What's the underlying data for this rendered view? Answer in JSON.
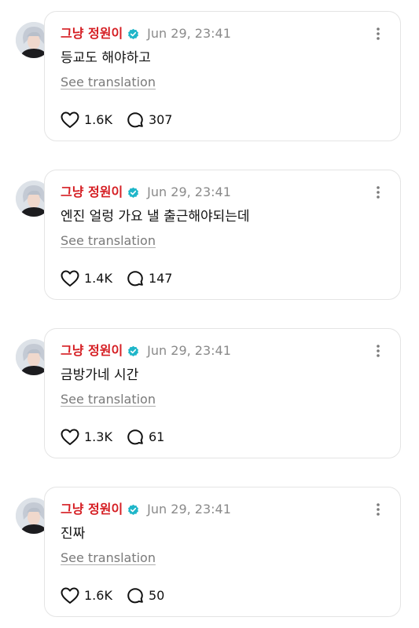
{
  "posts": [
    {
      "username": "그냥 정원이",
      "time": "Jun 29, 23:41",
      "text": "등교도 해야하고",
      "translate_label": "See translation",
      "likes": "1.6K",
      "comments": "307"
    },
    {
      "username": "그냥 정원이",
      "time": "Jun 29, 23:41",
      "text": "엔진 얼렁 가요 낼 출근해야되는데",
      "translate_label": "See translation",
      "likes": "1.4K",
      "comments": "147"
    },
    {
      "username": "그냥 정원이",
      "time": "Jun 29, 23:41",
      "text": "금방가네 시간",
      "translate_label": "See translation",
      "likes": "1.3K",
      "comments": "61"
    },
    {
      "username": "그냥 정원이",
      "time": "Jun 29, 23:41",
      "text": "진짜",
      "translate_label": "See translation",
      "likes": "1.6K",
      "comments": "50"
    }
  ],
  "colors": {
    "username": "#d51d22",
    "verified": "#1fb6c9",
    "muted": "#8a8a8a"
  },
  "icons": {
    "verified": "verified-badge-icon",
    "more": "more-vertical-icon",
    "like": "heart-icon",
    "comment": "comment-bubble-icon"
  }
}
